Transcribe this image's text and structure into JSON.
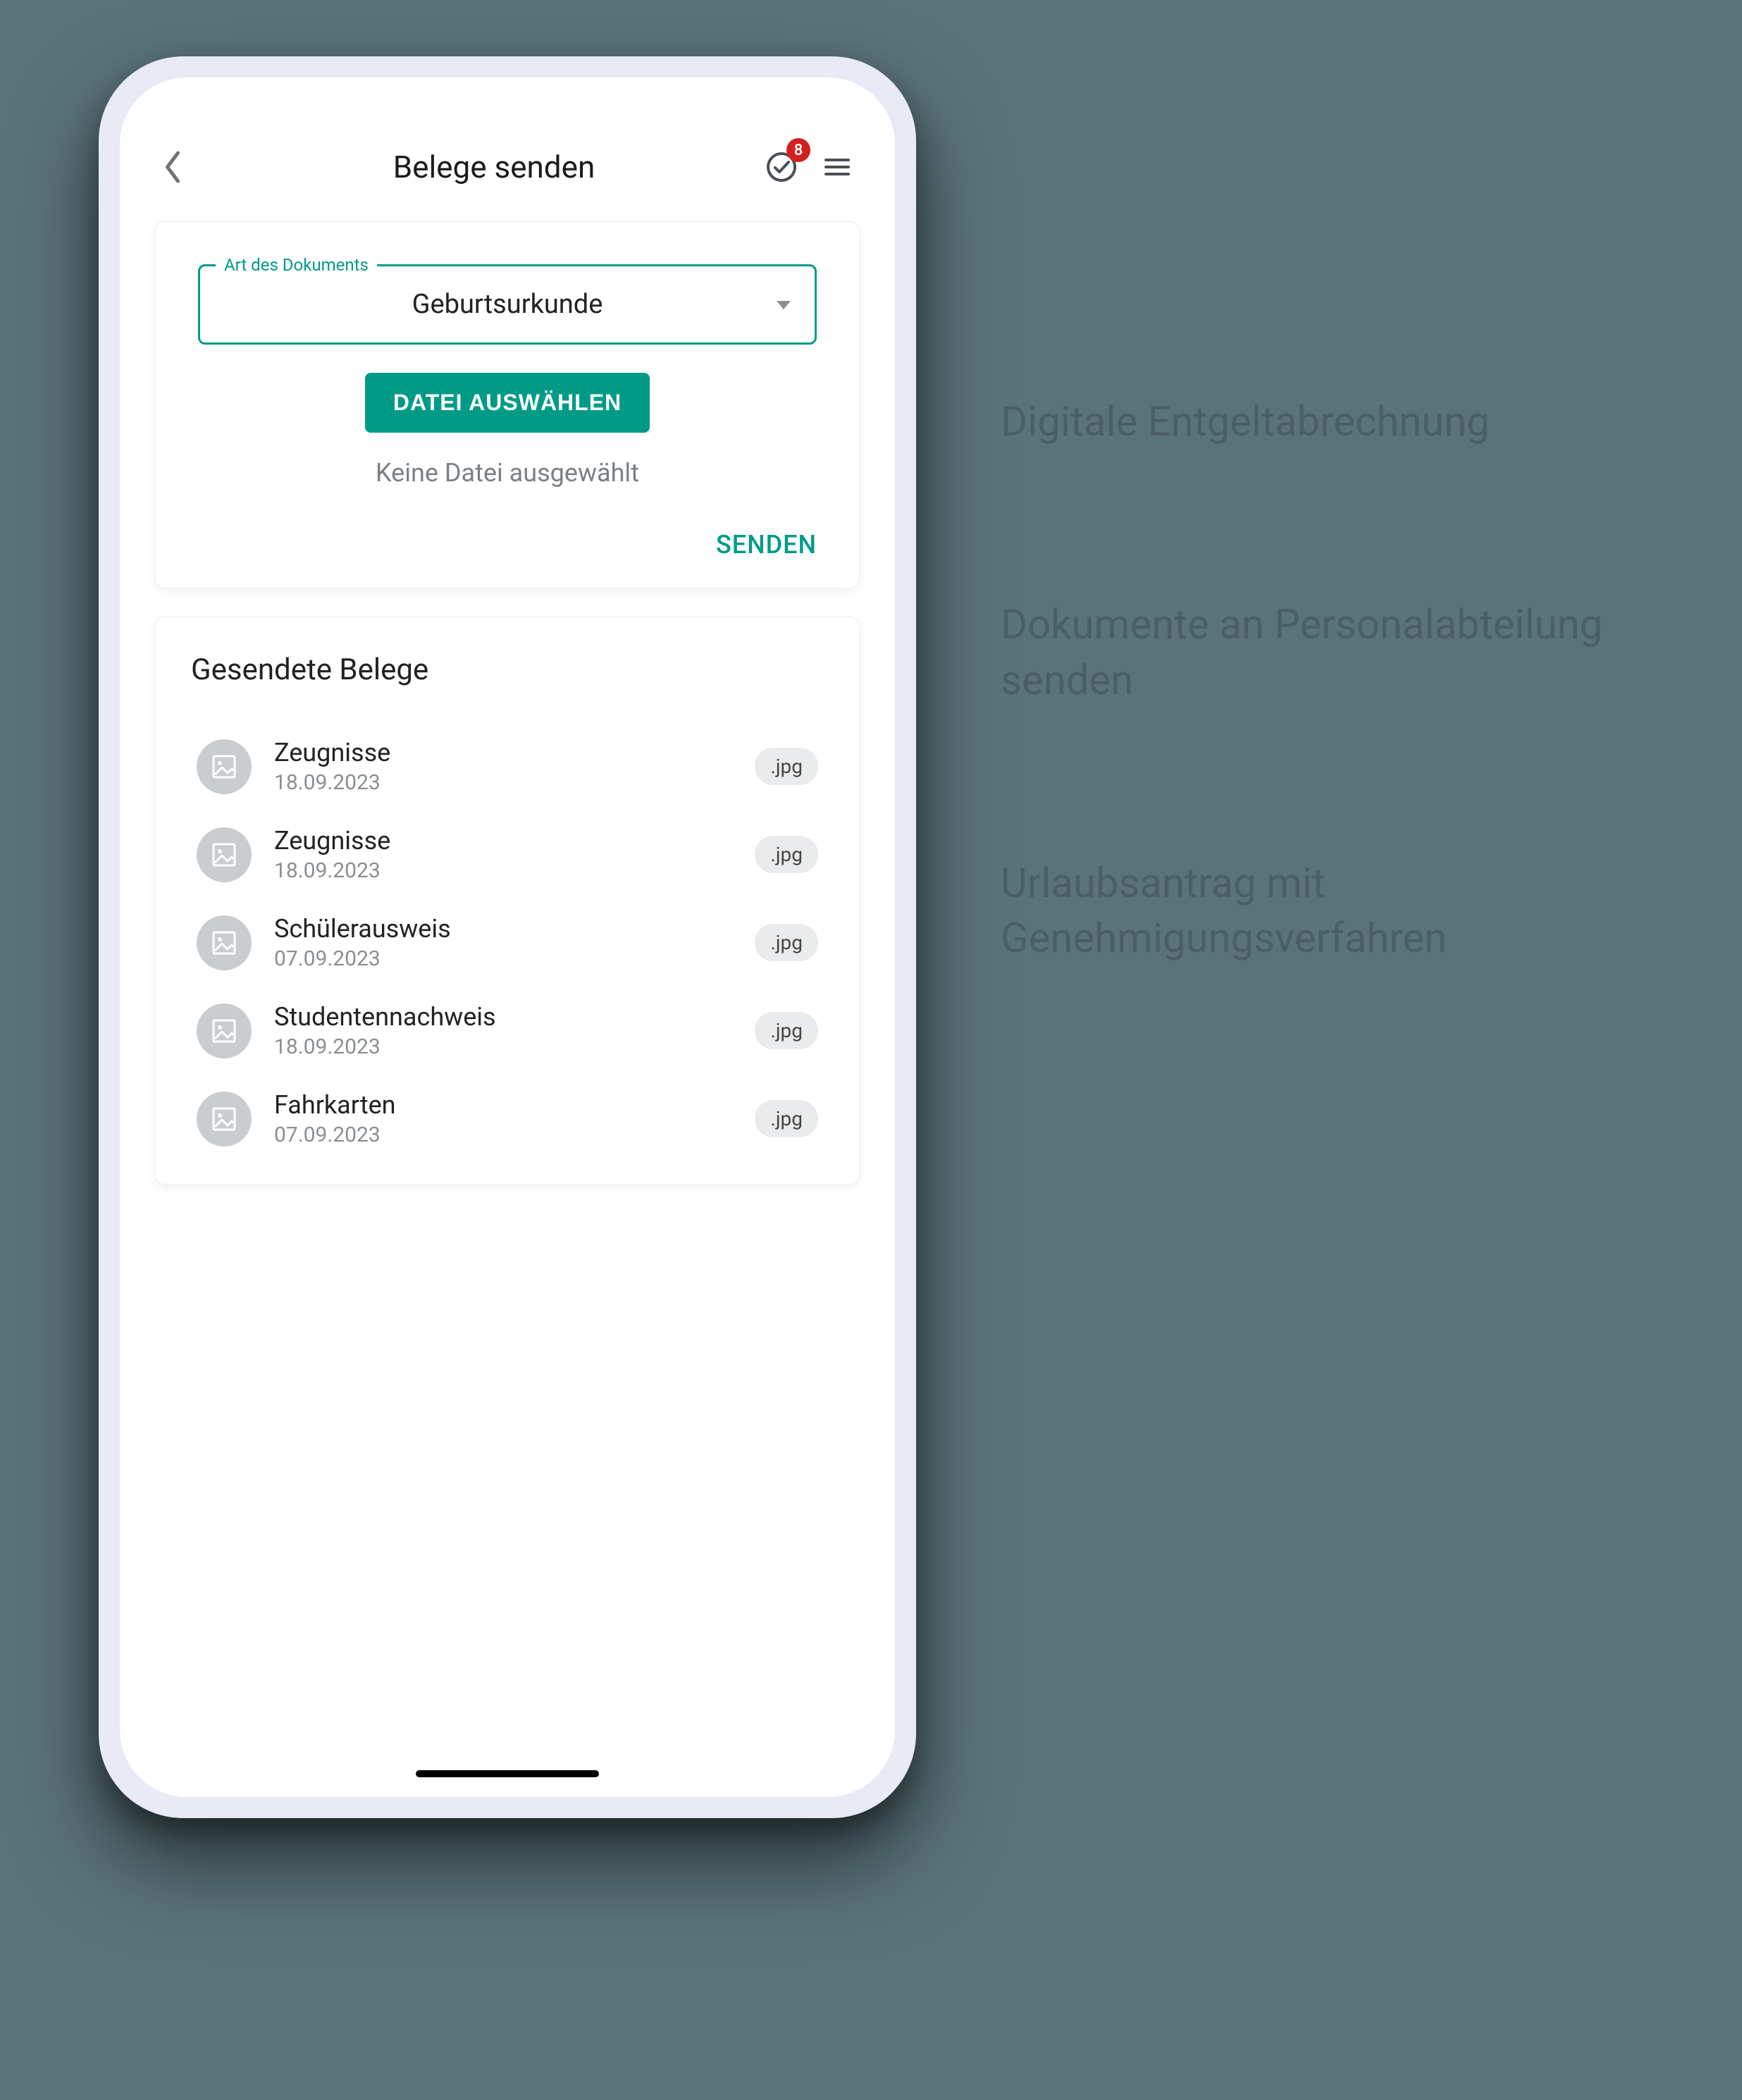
{
  "header": {
    "title": "Belege senden",
    "badge_count": "8"
  },
  "upload": {
    "field_legend": "Art des Dokuments",
    "field_value": "Geburtsurkunde",
    "choose_file_button": "DATEI AUSWÄHLEN",
    "no_file_hint": "Keine Datei ausgewählt",
    "send_button": "SENDEN"
  },
  "sent": {
    "heading": "Gesendete Belege",
    "items": [
      {
        "title": "Zeugnisse",
        "date": "18.09.2023",
        "ext": ".jpg"
      },
      {
        "title": "Zeugnisse",
        "date": "18.09.2023",
        "ext": ".jpg"
      },
      {
        "title": "Schülerausweis",
        "date": "07.09.2023",
        "ext": ".jpg"
      },
      {
        "title": "Studentennachweis",
        "date": "18.09.2023",
        "ext": ".jpg"
      },
      {
        "title": "Fahrkarten",
        "date": "07.09.2023",
        "ext": ".jpg"
      }
    ]
  },
  "side": {
    "caption_1": "Digitale Entgeltabrechnung",
    "caption_2": "Dokumente an Personalabteilung senden",
    "caption_3": "Urlaubsantrag mit Genehmigungsverfahren"
  }
}
